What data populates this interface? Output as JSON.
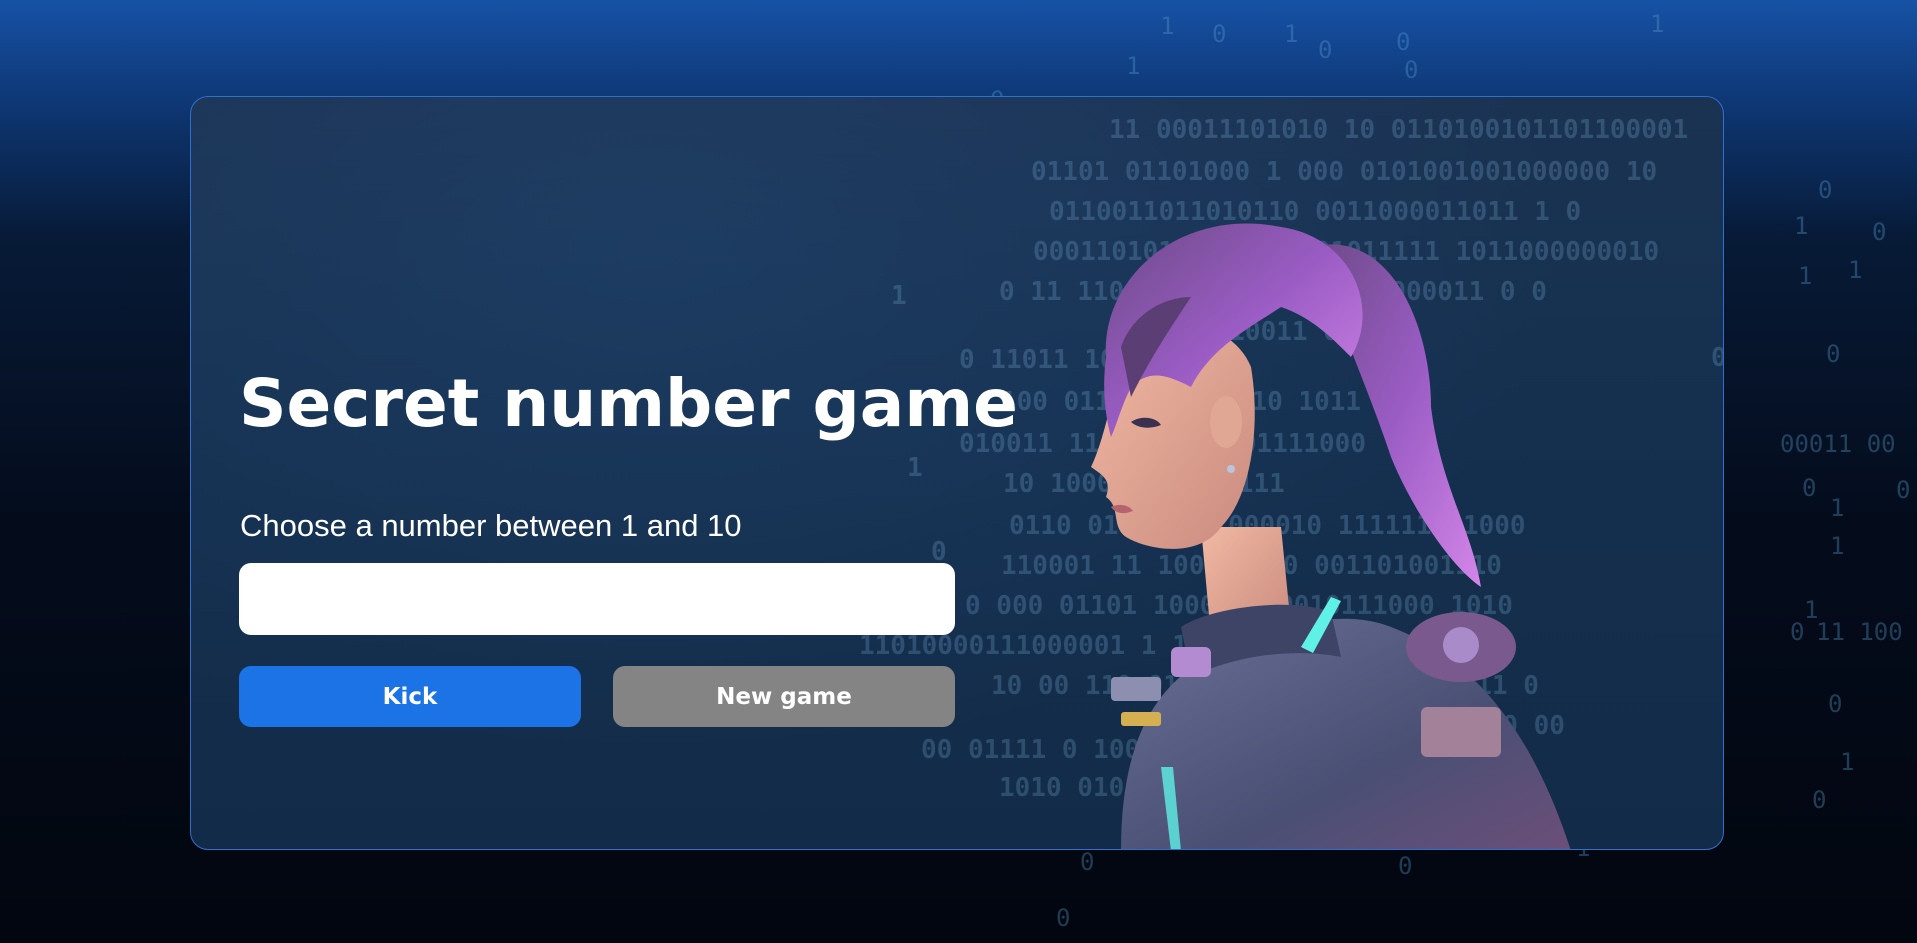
{
  "game": {
    "title": "Secret number game",
    "prompt": "Choose a number between 1 and 10",
    "input_value": "",
    "kick_label": "Kick",
    "new_game_label": "New game"
  },
  "colors": {
    "kick_button": "#1b73e6",
    "new_game_button": "#848484",
    "card_border": "#2f6fd0",
    "hair": "#9a5cc4",
    "suit": "#5a5f86",
    "accent_glow": "#5ff0e6"
  },
  "illustration": {
    "subject": "character-illustration"
  }
}
